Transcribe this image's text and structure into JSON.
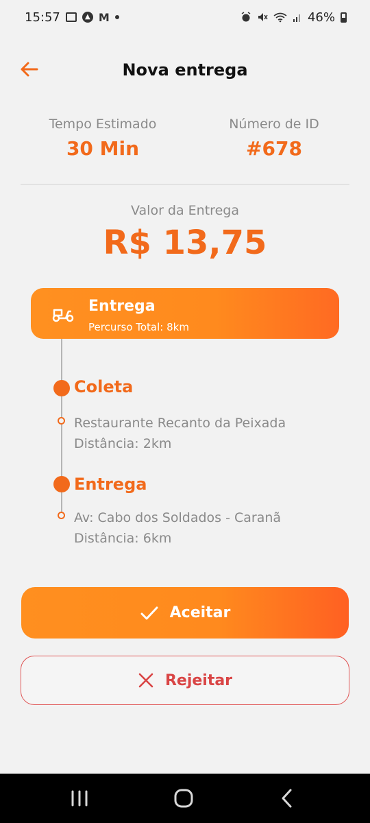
{
  "status_bar": {
    "time": "15:57",
    "battery": "46%",
    "left_icons": [
      "gallery-icon",
      "assistant-icon",
      "gmail-icon",
      "dot-icon"
    ],
    "right_icons": [
      "alarm-icon",
      "mute-icon",
      "wifi-icon",
      "signal-icon",
      "battery-icon"
    ]
  },
  "header": {
    "title": "Nova entrega",
    "back_icon": "arrow-left-icon"
  },
  "stats": {
    "time_label": "Tempo Estimado",
    "time_value": "30 Min",
    "id_label": "Número de ID",
    "id_value": "#678"
  },
  "delivery_value": {
    "label": "Valor da Entrega",
    "amount": "R$ 13,75"
  },
  "delivery_card": {
    "icon": "scooter-icon",
    "title": "Entrega",
    "subtitle": "Percurso Total: 8km"
  },
  "timeline": {
    "pickup": {
      "title": "Coleta",
      "line1": "Restaurante Recanto da Peixada",
      "line2": "Distância: 2km"
    },
    "dropoff": {
      "title": "Entrega",
      "line1": "Av: Cabo dos Soldados - Caranã",
      "line2": "Distância: 6km"
    }
  },
  "actions": {
    "accept_label": "Aceitar",
    "accept_icon": "check-icon",
    "reject_label": "Rejeitar",
    "reject_icon": "close-icon"
  },
  "navigation": {
    "recents_icon": "recents-icon",
    "home_icon": "home-icon",
    "back_icon": "nav-back-icon"
  },
  "colors": {
    "accent": "#f26a1b",
    "reject": "#d94545",
    "background": "#f2f2f2"
  }
}
